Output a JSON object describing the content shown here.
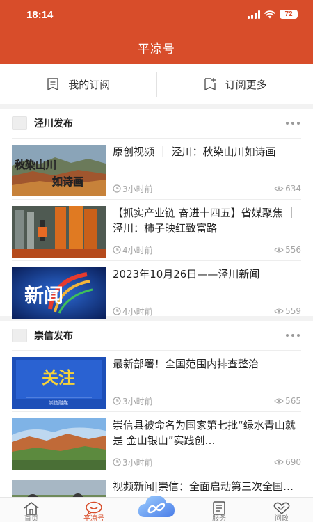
{
  "status": {
    "time": "18:14",
    "battery": "72"
  },
  "header": {
    "title": "平凉号"
  },
  "subscription": {
    "mine": "我的订阅",
    "more": "订阅更多"
  },
  "sections": [
    {
      "name": "泾川发布",
      "items": [
        {
          "title": "原创视频 ｜ 泾川：秋染山川如诗画",
          "time": "3小时前",
          "views": "634",
          "thumb_text": "秋染山川 如诗画"
        },
        {
          "title": "【抓实产业链 奋进十四五】省媒聚焦 ｜ 泾川：柿子映红致富路",
          "time": "4小时前",
          "views": "556"
        },
        {
          "title": "2023年10月26日——泾川新闻",
          "time": "4小时前",
          "views": "559",
          "thumb_text": "新闻"
        }
      ]
    },
    {
      "name": "崇信发布",
      "items": [
        {
          "title": "最新部署！全国范围内排查整治",
          "time": "3小时前",
          "views": "565",
          "thumb_text": "关注",
          "thumb_sub": "崇信融媒"
        },
        {
          "title": "崇信县被命名为国家第七批“绿水青山就是 金山银山”实践创…",
          "time": "3小时前",
          "views": "690"
        },
        {
          "title": "视频新闻|崇信：全面启动第三次全国…"
        }
      ]
    }
  ],
  "tabbar": {
    "tabs": [
      "首页",
      "平凉号",
      "服务",
      "问政"
    ]
  },
  "colors": {
    "brand": "#d84d2a",
    "accent_blue": "#2a6fe0"
  },
  "icons": [
    "cellular-signal-icon",
    "wifi-icon",
    "battery-icon",
    "subscribe-list-icon",
    "subscribe-add-icon",
    "clock-icon",
    "eye-icon",
    "home-icon",
    "chat-icon",
    "cloud-icon",
    "service-icon",
    "handshake-icon"
  ]
}
